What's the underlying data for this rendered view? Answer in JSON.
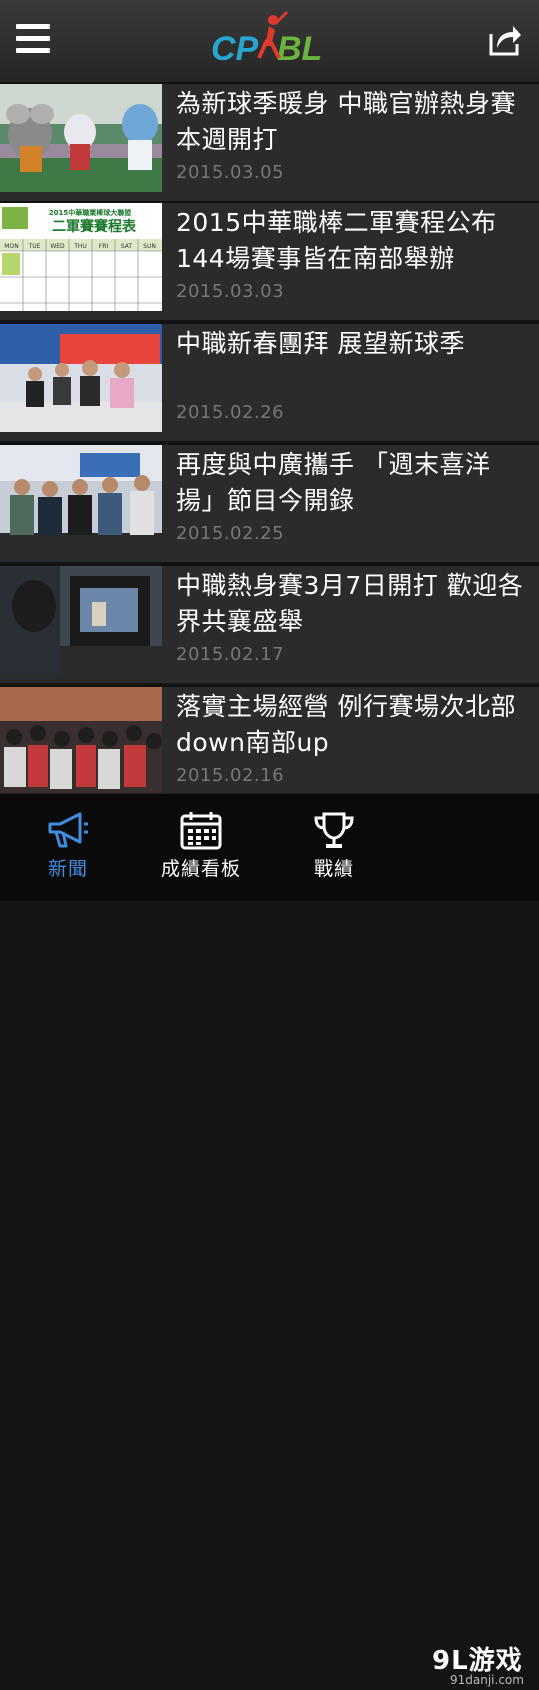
{
  "app": {
    "logo_text": "CPBL"
  },
  "news": [
    {
      "title": "為新球季暖身 中職官辦熱身賽本週開打",
      "date": "2015.03.05",
      "image": "mascots-photo"
    },
    {
      "title": "2015中華職棒二軍賽程公布 144場賽事皆在南部舉辦",
      "date": "2015.03.03",
      "image": "calendar-photo"
    },
    {
      "title": "中職新春團拜 展望新球季",
      "date": "2015.02.26",
      "image": "press-conference-photo"
    },
    {
      "title": "再度與中廣攜手 「週末喜洋揚」節目今開錄",
      "date": "2015.02.25",
      "image": "radio-studio-photo"
    },
    {
      "title": "中職熱身賽3月7日開打 歡迎各界共襄盛舉",
      "date": "2015.02.17",
      "image": "camera-photo"
    },
    {
      "title": "落實主場經營 例行賽場次北部down南部up",
      "date": "2015.02.16",
      "image": "crowd-photo"
    }
  ],
  "thumb_text": {
    "calendar_banner_top": "2015中華職業棒球大聯盟",
    "calendar_banner_main": "二軍賽賽程表",
    "calendar_days": [
      "MON",
      "TUE",
      "WED",
      "THU",
      "FRI",
      "SAT",
      "SUN"
    ]
  },
  "tabs": [
    {
      "label": "新聞",
      "icon": "megaphone-icon",
      "active": true
    },
    {
      "label": "成績看板",
      "icon": "calendar-icon",
      "active": false
    },
    {
      "label": "戰績",
      "icon": "trophy-icon",
      "active": false
    }
  ],
  "watermark": {
    "big": "9L游戏",
    "small": "91danji.com"
  },
  "colors": {
    "accent": "#3d8de0",
    "topbar": "#2e2e2e",
    "item_bg": "#2b2b2b",
    "date": "#777777"
  }
}
